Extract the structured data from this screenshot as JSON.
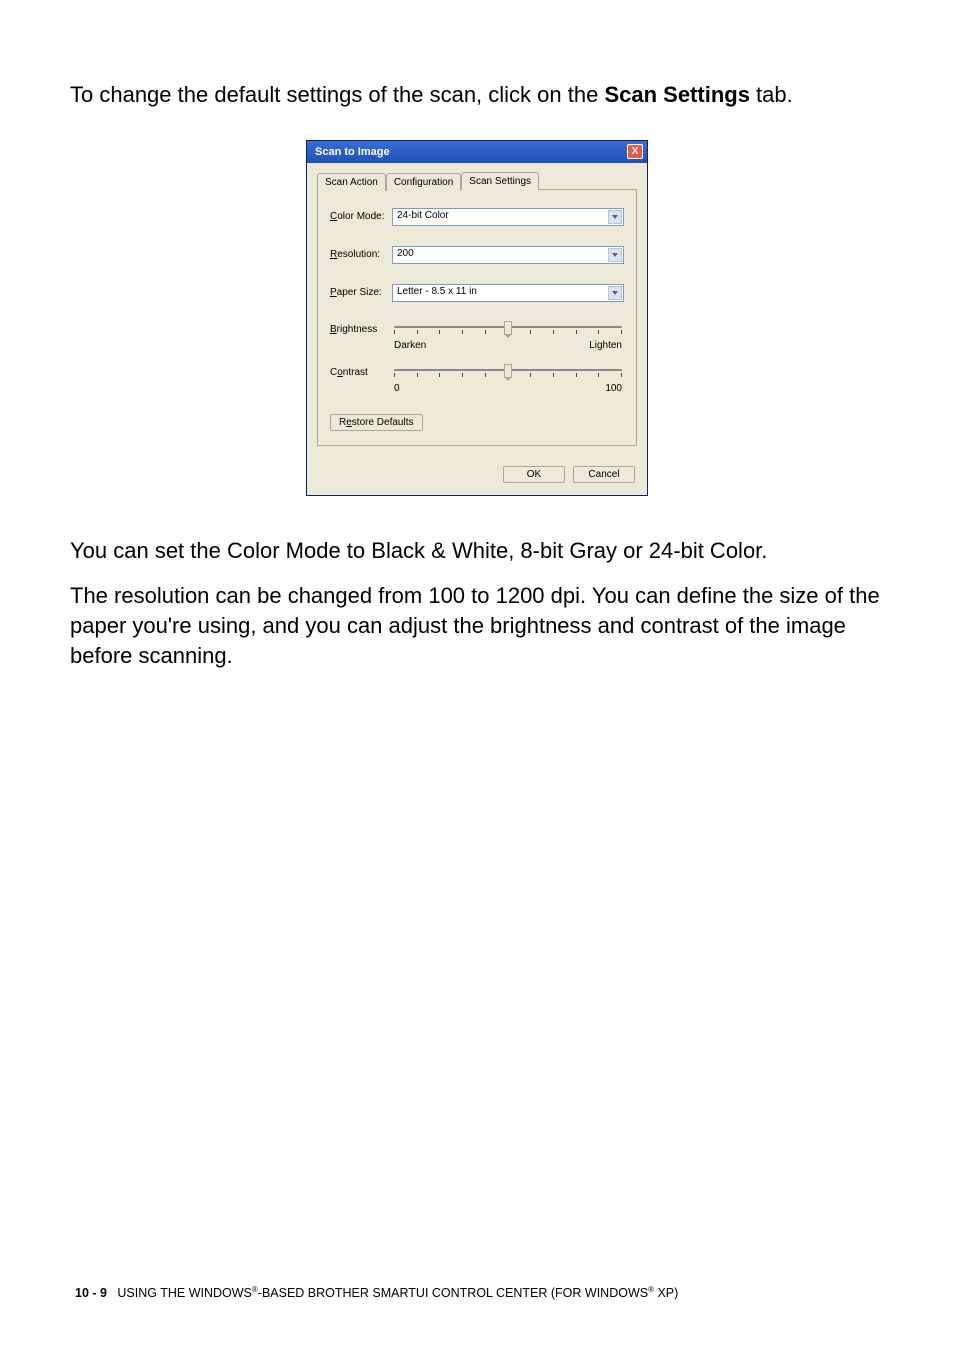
{
  "intro": {
    "pre": "To change the default settings of the scan, click on the ",
    "bold": "Scan Settings",
    "post": " tab."
  },
  "dialog": {
    "title": "Scan to Image",
    "close": "X",
    "tabs": {
      "t1": "Scan Action",
      "t2": "Configuration",
      "t3": "Scan Settings"
    },
    "fields": {
      "color_label_u": "C",
      "color_label_rest": "olor Mode:",
      "color_value": "24-bit Color",
      "res_label_u": "R",
      "res_label_rest": "esolution:",
      "res_value": "200",
      "paper_label_u": "P",
      "paper_label_rest": "aper Size:",
      "paper_value": "Letter - 8.5  x 11 in",
      "bright_label_u": "B",
      "bright_label_rest": "rightness",
      "bright_left": "Darken",
      "bright_right": "Lighten",
      "contrast_label_u": "o",
      "contrast_label_pre": "C",
      "contrast_label_rest": "ntrast",
      "contrast_left": "0",
      "contrast_right": "100",
      "restore_u": "e",
      "restore_pre": "R",
      "restore_rest": "store Defaults"
    },
    "buttons": {
      "ok": "OK",
      "cancel": "Cancel"
    }
  },
  "para1": "You can set the Color Mode to Black & White, 8-bit Gray or 24-bit Color.",
  "para2": "The resolution can be changed from 100 to 1200 dpi. You can define the size of the paper you're using, and you can adjust the brightness and contrast of the image before scanning.",
  "footer": {
    "pageref": "10 - 9",
    "text_pre": "USING THE WINDOWS",
    "reg": "®",
    "text_mid": "-BASED BROTHER SMARTUI CONTROL CENTER (FOR WINDOWS",
    "text_post": " XP)"
  }
}
